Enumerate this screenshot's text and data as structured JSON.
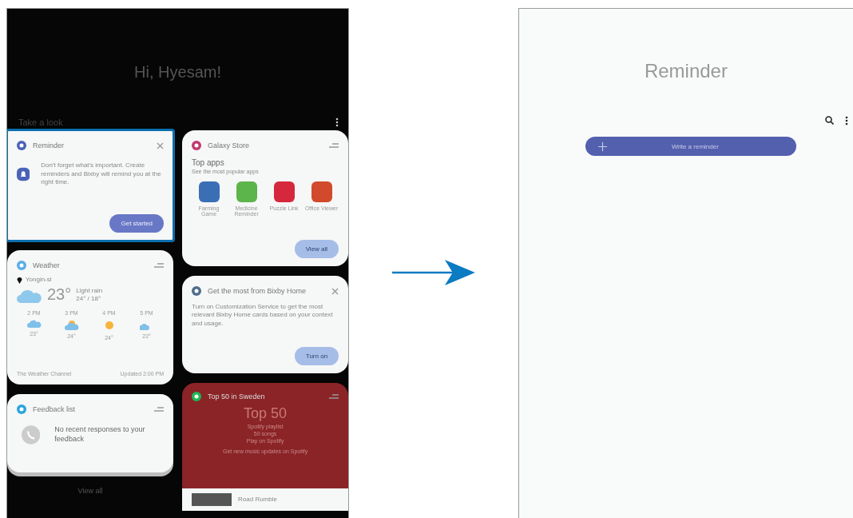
{
  "home_screen": {
    "greeting": "Hi, Hyesam!",
    "section_title": "Take a look",
    "left_cards": [
      {
        "kind": "reminder",
        "title": "Reminder",
        "selected": true,
        "body": "Don't forget what's important. Create reminders and Bixby will remind you at the right time.",
        "button": "Get started"
      },
      {
        "kind": "weather",
        "title": "Weather",
        "location": "Yongin-si",
        "temperature": "23°",
        "condition": "Light rain",
        "range": "24° / 18°",
        "hours": [
          {
            "time": "2 PM",
            "temp": "23°"
          },
          {
            "time": "3 PM",
            "temp": "24°"
          },
          {
            "time": "4 PM",
            "temp": "24°"
          },
          {
            "time": "5 PM",
            "temp": "22°"
          }
        ],
        "source": "The Weather Channel",
        "updated": "Updated 2:00 PM"
      },
      {
        "kind": "feedback",
        "title": "Feedback list",
        "body": "No recent responses to your feedback"
      }
    ],
    "right_cards": [
      {
        "kind": "store",
        "title": "Galaxy Store",
        "heading": "Top apps",
        "subheading": "See the most popular apps",
        "apps": [
          {
            "name": "Farming Game"
          },
          {
            "name": "Medicine Reminder"
          },
          {
            "name": "Puzzle Link"
          },
          {
            "name": "Office Viewer"
          }
        ],
        "button": "View all"
      },
      {
        "kind": "bixby",
        "title": "Get the most from Bixby Home",
        "body": "Turn on Customization Service to get the most relevant Bixby Home cards based on your context and usage.",
        "button": "Turn on"
      },
      {
        "kind": "music",
        "title": "Top 50 in Sweden",
        "heading": "Top 50",
        "line_1": "Spotify playlist",
        "line_2": "50 songs",
        "line_3": "Play on Spotify",
        "footer": "Get new music updates on Spotify",
        "track": "Road Rumble"
      }
    ],
    "view_all": "View all"
  },
  "reminder_screen": {
    "title": "Reminder",
    "add_button": "Write a reminder"
  }
}
